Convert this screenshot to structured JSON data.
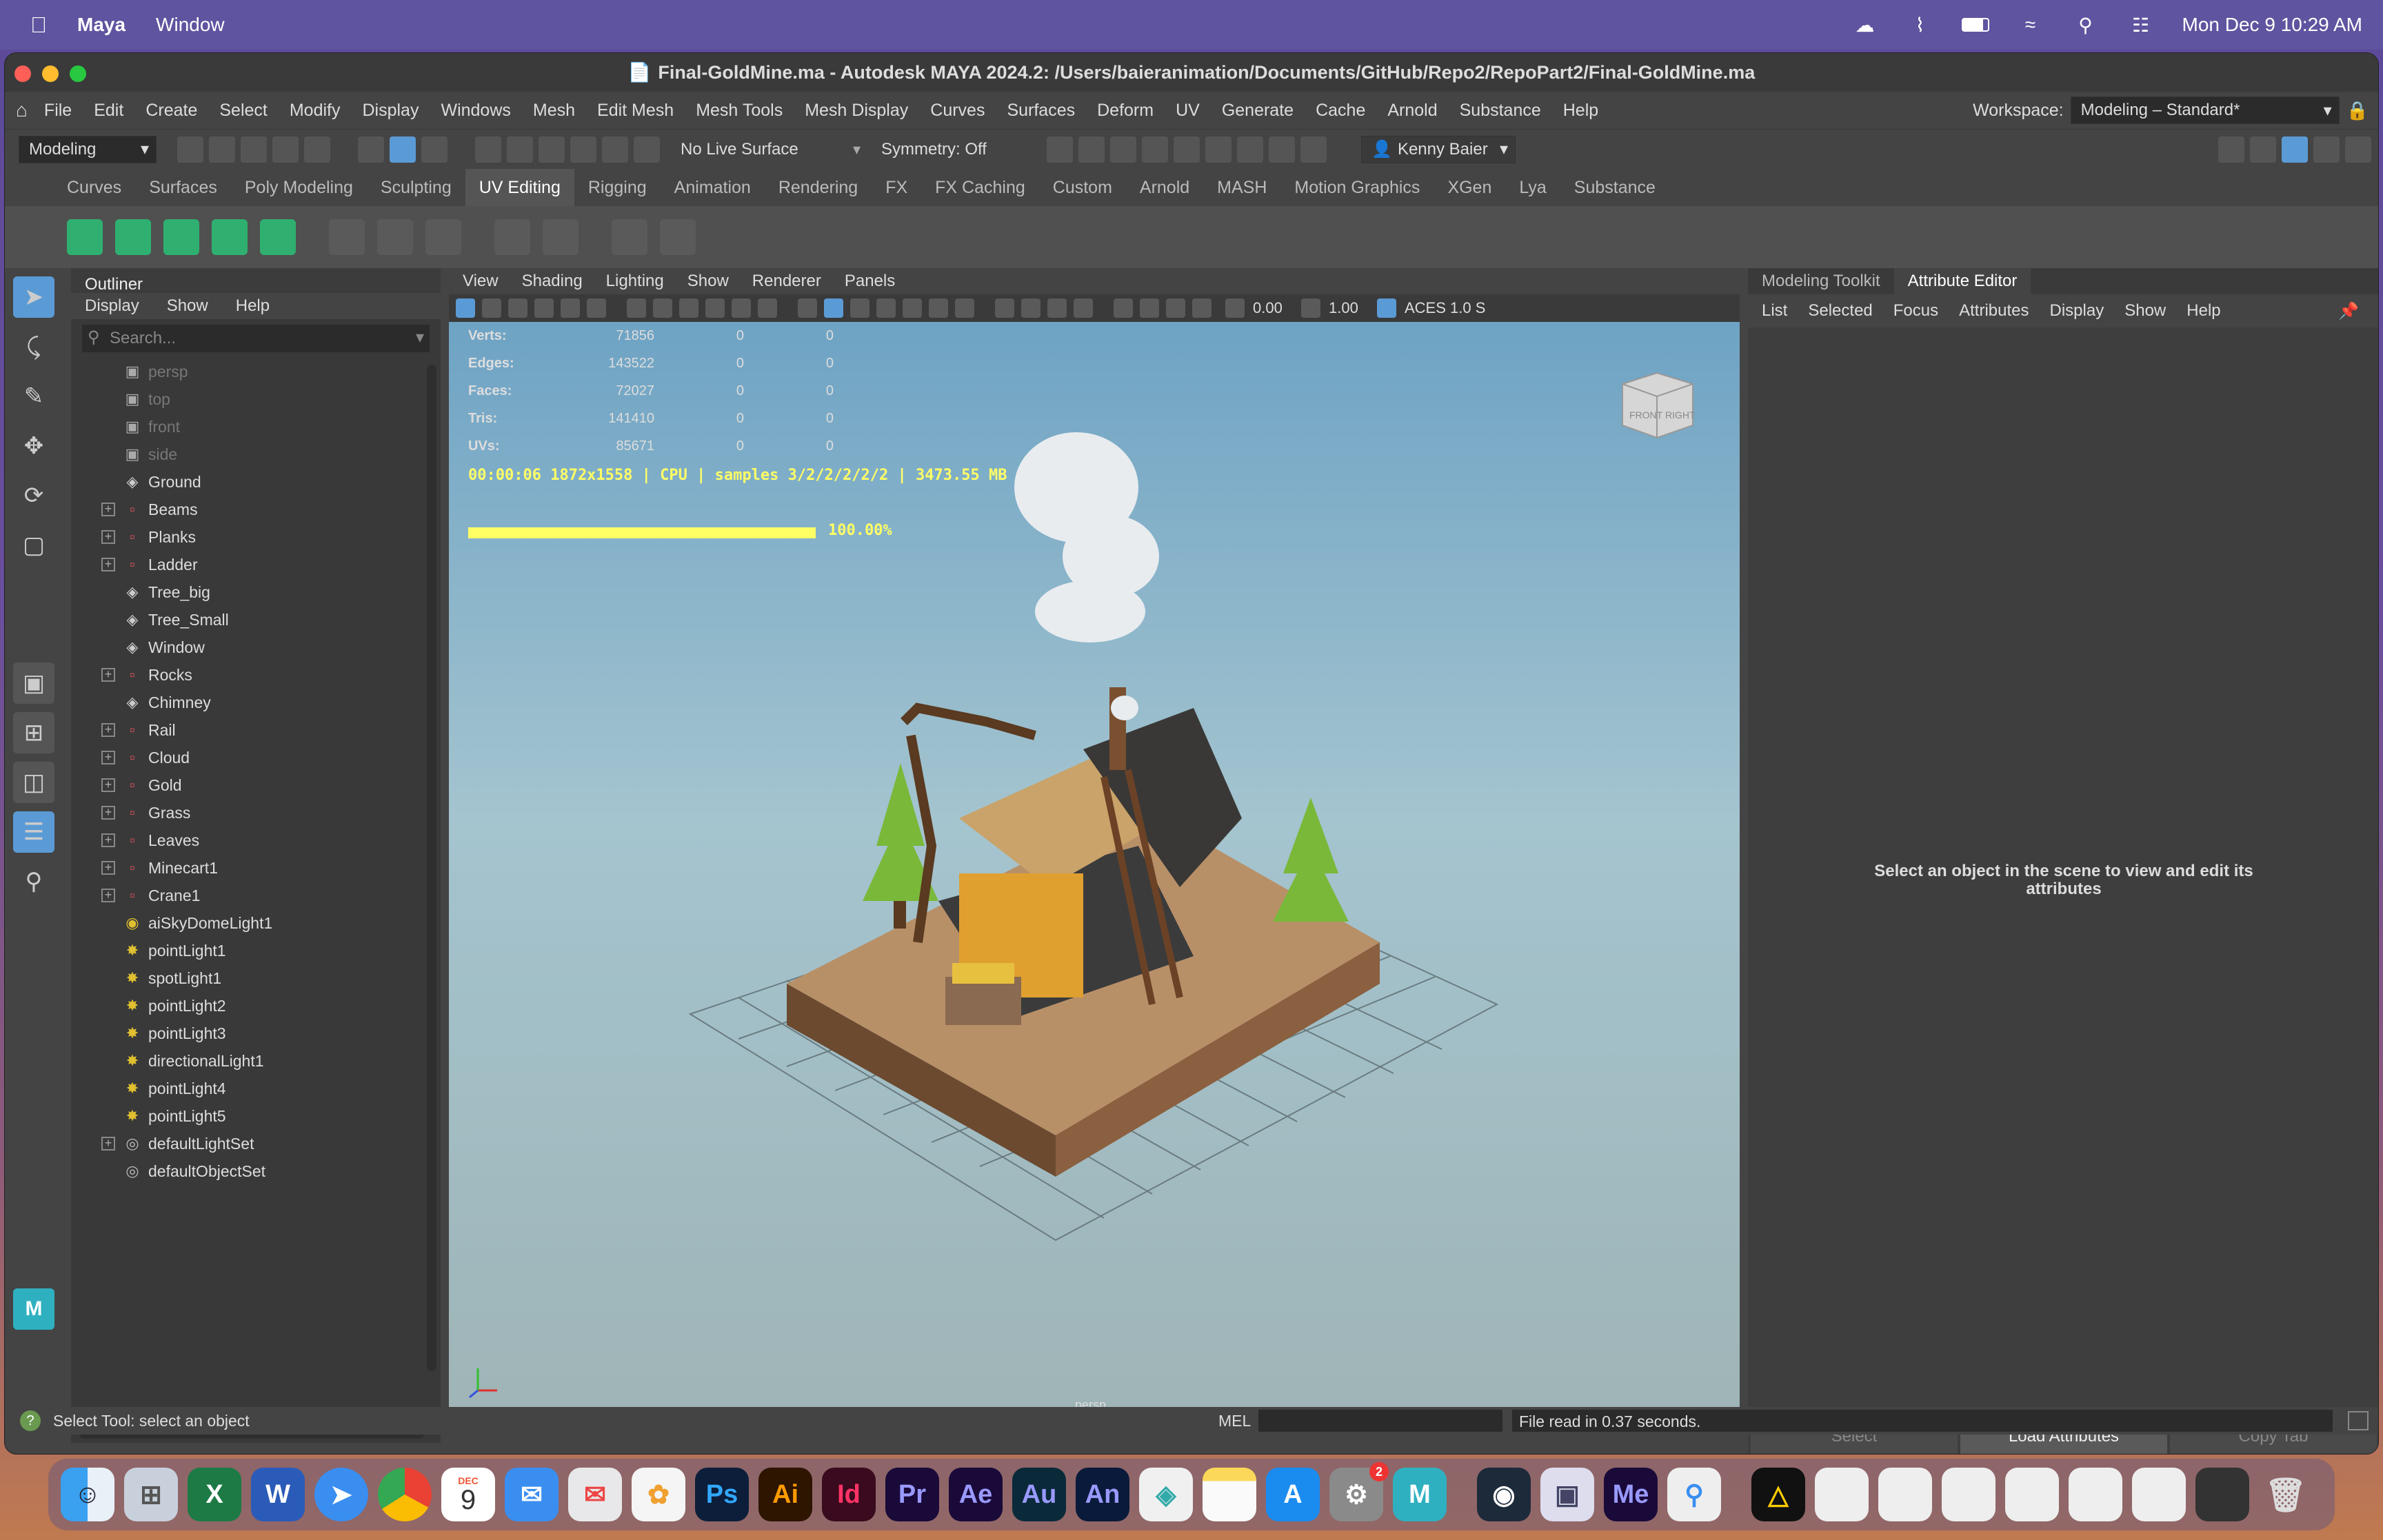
{
  "macos": {
    "apple_glyph": "",
    "menu": [
      "Maya",
      "Window"
    ],
    "clock": "Mon Dec 9  10:29 AM"
  },
  "window": {
    "title": "Final-GoldMine.ma - Autodesk MAYA 2024.2: /Users/baieranimation/Documents/GitHub/Repo2/RepoPart2/Final-GoldMine.ma"
  },
  "main_menu": [
    "File",
    "Edit",
    "Create",
    "Select",
    "Modify",
    "Display",
    "Windows",
    "Mesh",
    "Edit Mesh",
    "Mesh Tools",
    "Mesh Display",
    "Curves",
    "Surfaces",
    "Deform",
    "UV",
    "Generate",
    "Cache",
    "Arnold",
    "Substance",
    "Help"
  ],
  "workspace": {
    "label": "Workspace:",
    "value": "Modeling – Standard*"
  },
  "status_line": {
    "mode": "Modeling",
    "live_surface": "No Live Surface",
    "symmetry": "Symmetry: Off",
    "user": "Kenny Baier"
  },
  "shelf_tabs": [
    "Curves",
    "Surfaces",
    "Poly Modeling",
    "Sculpting",
    "UV Editing",
    "Rigging",
    "Animation",
    "Rendering",
    "FX",
    "FX Caching",
    "Custom",
    "Arnold",
    "MASH",
    "Motion Graphics",
    "XGen",
    "Lya",
    "Substance"
  ],
  "active_shelf_tab": "UV Editing",
  "outliner": {
    "title": "Outliner",
    "menu": [
      "Display",
      "Show",
      "Help"
    ],
    "search_placeholder": "Search...",
    "items": [
      {
        "label": "persp",
        "icon": "camera-icon",
        "expandable": false,
        "dim": true
      },
      {
        "label": "top",
        "icon": "camera-icon",
        "expandable": false,
        "dim": true
      },
      {
        "label": "front",
        "icon": "camera-icon",
        "expandable": false,
        "dim": true
      },
      {
        "label": "side",
        "icon": "camera-icon",
        "expandable": false,
        "dim": true
      },
      {
        "label": "Ground",
        "icon": "mesh-icon",
        "expandable": false
      },
      {
        "label": "Beams",
        "icon": "group-icon",
        "expandable": true
      },
      {
        "label": "Planks",
        "icon": "group-icon",
        "expandable": true
      },
      {
        "label": "Ladder",
        "icon": "group-icon",
        "expandable": true
      },
      {
        "label": "Tree_big",
        "icon": "mesh-icon",
        "expandable": false
      },
      {
        "label": "Tree_Small",
        "icon": "mesh-icon",
        "expandable": false
      },
      {
        "label": "Window",
        "icon": "mesh-icon",
        "expandable": false
      },
      {
        "label": "Rocks",
        "icon": "group-icon",
        "expandable": true
      },
      {
        "label": "Chimney",
        "icon": "mesh-icon",
        "expandable": false
      },
      {
        "label": "Rail",
        "icon": "group-icon",
        "expandable": true
      },
      {
        "label": "Cloud",
        "icon": "group-icon",
        "expandable": true
      },
      {
        "label": "Gold",
        "icon": "group-icon",
        "expandable": true
      },
      {
        "label": "Grass",
        "icon": "group-icon",
        "expandable": true
      },
      {
        "label": "Leaves",
        "icon": "group-icon",
        "expandable": true
      },
      {
        "label": "Minecart1",
        "icon": "group-icon",
        "expandable": true
      },
      {
        "label": "Crane1",
        "icon": "group-icon",
        "expandable": true
      },
      {
        "label": "aiSkyDomeLight1",
        "icon": "skydome-icon",
        "expandable": false
      },
      {
        "label": "pointLight1",
        "icon": "light-icon",
        "expandable": false
      },
      {
        "label": "spotLight1",
        "icon": "light-icon",
        "expandable": false
      },
      {
        "label": "pointLight2",
        "icon": "light-icon",
        "expandable": false
      },
      {
        "label": "pointLight3",
        "icon": "light-icon",
        "expandable": false
      },
      {
        "label": "directionalLight1",
        "icon": "light-icon",
        "expandable": false
      },
      {
        "label": "pointLight4",
        "icon": "light-icon",
        "expandable": false
      },
      {
        "label": "pointLight5",
        "icon": "light-icon",
        "expandable": false
      },
      {
        "label": "defaultLightSet",
        "icon": "set-icon",
        "expandable": true
      },
      {
        "label": "defaultObjectSet",
        "icon": "set-icon",
        "expandable": false
      }
    ]
  },
  "viewport": {
    "menu": [
      "View",
      "Shading",
      "Lighting",
      "Show",
      "Renderer",
      "Panels"
    ],
    "exposure": "0.00",
    "gamma": "1.00",
    "colorspace": "ACES 1.0 S",
    "hud": [
      {
        "k": "Verts:",
        "v": "71856",
        "a": "0",
        "b": "0"
      },
      {
        "k": "Edges:",
        "v": "143522",
        "a": "0",
        "b": "0"
      },
      {
        "k": "Faces:",
        "v": "72027",
        "a": "0",
        "b": "0"
      },
      {
        "k": "Tris:",
        "v": "141410",
        "a": "0",
        "b": "0"
      },
      {
        "k": "UVs:",
        "v": "85671",
        "a": "0",
        "b": "0"
      }
    ],
    "render_info": "00:00:06 1872x1558 | CPU | samples 3/2/2/2/2/2 | 3473.55 MB",
    "progress": 1.0,
    "progress_label": "100.00%",
    "camera_label": "persp",
    "viewcube_front": "FRONT",
    "viewcube_right": "RIGHT"
  },
  "attribute_editor": {
    "tabs": [
      "Modeling Toolkit",
      "Attribute Editor"
    ],
    "active_tab": "Attribute Editor",
    "menu": [
      "List",
      "Selected",
      "Focus",
      "Attributes",
      "Display",
      "Show",
      "Help"
    ],
    "message": "Select an object in the scene to view and edit its attributes",
    "buttons": [
      "Select",
      "Load Attributes",
      "Copy Tab"
    ]
  },
  "status_bar": {
    "help": "Select Tool: select an object",
    "mel_label": "MEL",
    "feedback": "File read in  0.37 seconds."
  },
  "dock": {
    "calendar_month": "DEC",
    "calendar_day": "9",
    "settings_badge": "2",
    "labels": [
      "Ps",
      "Ai",
      "Id",
      "Pr",
      "Ae",
      "Au",
      "An",
      "Me"
    ]
  },
  "colors": {
    "accent": "#5b9bd5",
    "hud_yellow": "#ffff66",
    "shelf_green": "#2fb070"
  }
}
